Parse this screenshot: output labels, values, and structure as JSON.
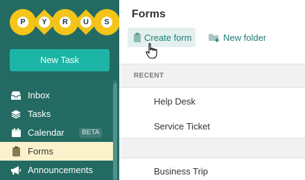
{
  "logo": {
    "letters": [
      "P",
      "Y",
      "R",
      "U",
      "S"
    ],
    "colors": [
      "#f5c518",
      "#f0c419",
      "#f3c41a",
      "#efc31a",
      "#f3c518"
    ]
  },
  "sidebar": {
    "new_task_label": "New Task",
    "items": [
      {
        "label": "Inbox",
        "icon": "inbox-icon"
      },
      {
        "label": "Tasks",
        "icon": "layers-icon"
      },
      {
        "label": "Calendar",
        "icon": "calendar-icon",
        "badge": "BETA"
      },
      {
        "label": "Forms",
        "icon": "clipboard-icon",
        "active": true
      },
      {
        "label": "Announcements",
        "icon": "megaphone-icon"
      }
    ]
  },
  "main": {
    "title": "Forms",
    "create_form_label": "Create form",
    "new_folder_label": "New folder",
    "recent_label": "RECENT",
    "recent_items": [
      "Help Desk",
      "Service Ticket"
    ],
    "other_items": [
      "Business Trip"
    ]
  },
  "colors": {
    "sidebar": "#236a63",
    "accent": "#1cb5a5",
    "active_bg": "#fbf2cc",
    "link": "#1f7f78"
  }
}
